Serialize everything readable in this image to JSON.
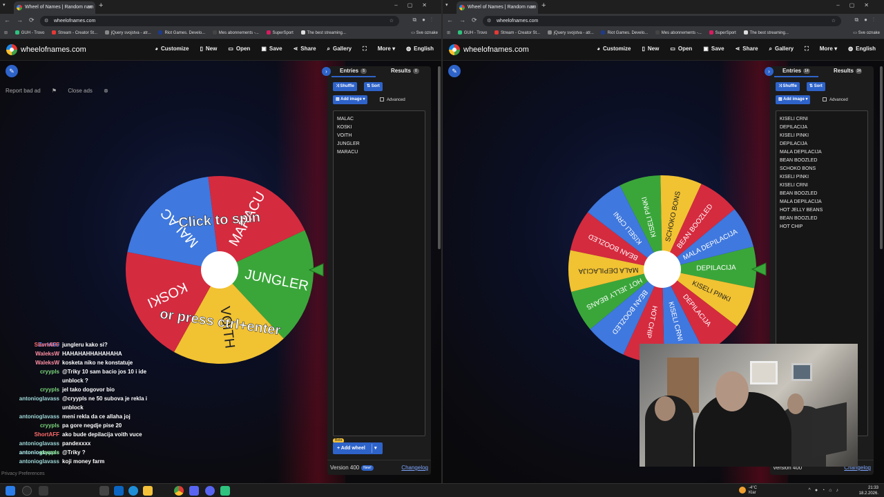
{
  "left": {
    "tab_title": "Wheel of Names | Random nam",
    "url": "wheelofnames.com",
    "bookmarks": [
      "GUH - Trovo",
      "Stream - Creator St...",
      "jQuery svojstva - atr...",
      "Riot Games. Develo...",
      "Mes abonnements -...",
      "SuperSport",
      "The best streaming..."
    ],
    "bookmarks_end": "Sve oznake",
    "site_name": "wheelofnames.com",
    "menu": [
      "Customize",
      "New",
      "Open",
      "Save",
      "Share",
      "Gallery",
      "More",
      "English"
    ],
    "report_bad_ad": "Report bad ad",
    "close_ads": "Close ads",
    "tabs": {
      "entries": "Entries",
      "entries_count": "5",
      "results": "Results",
      "results_count": "0"
    },
    "buttons": {
      "shuffle": "Shuffle",
      "sort": "Sort",
      "add_image": "Add image",
      "advanced": "Advanced",
      "add_wheel": "Add wheel",
      "beta": "Beta"
    },
    "entries": [
      "MALAC",
      "KOSKI",
      "VOITH",
      "JUNGLER",
      "MARACU"
    ],
    "wheel": {
      "slices": [
        {
          "label": "JUNGLER",
          "color": "#3aa63a"
        },
        {
          "label": "VOITH",
          "color": "#f1c232"
        },
        {
          "label": "KOSKI",
          "color": "#d52b3f"
        },
        {
          "label": "MALAC",
          "color": "#3f78de"
        },
        {
          "label": "MARACU",
          "color": "#d52b3f"
        }
      ],
      "overlay_top": "Click to spin",
      "overlay_bottom": "or press ctrl+enter"
    },
    "version": "Version 400",
    "new_badge": "New!",
    "changelog": "Changelog",
    "privacy": "Privacy Preferences"
  },
  "right": {
    "tab_title": "Wheel of Names | Random nam",
    "url": "wheelofnames.com",
    "bookmarks": [
      "GUH - Trovo",
      "Stream - Creator St...",
      "jQuery svojstva - atr...",
      "Riot Games. Develo...",
      "Mes abonnements -...",
      "SuperSport",
      "The best streaming..."
    ],
    "bookmarks_end": "Sve oznake",
    "site_name": "wheelofnames.com",
    "menu": [
      "Customize",
      "New",
      "Open",
      "Save",
      "Share",
      "Gallery",
      "More",
      "English"
    ],
    "tabs": {
      "entries": "Entries",
      "entries_count": "14",
      "results": "Results",
      "results_count": "34"
    },
    "buttons": {
      "shuffle": "Shuffle",
      "sort": "Sort",
      "add_image": "Add image",
      "advanced": "Advanced"
    },
    "entries": [
      "KISELI CRNI",
      "DEPILACIJA",
      "KISELI PINKI",
      "DEPILACIJA",
      "MALA DEPILACIJA",
      "BEAN BOOZLED",
      "SCHOKO BONS",
      "KISELI PINKI",
      "KISELI CRNI",
      "BEAN BOOZLED",
      "MALA DEPILACIJA",
      "HOT JELLY BEANS",
      "BEAN BOOZLED",
      "HOT CHIP"
    ],
    "wheel": {
      "slices": [
        {
          "label": "DEPILACIJA",
          "color": "#3aa63a"
        },
        {
          "label": "KISELI PINKI",
          "color": "#f1c232"
        },
        {
          "label": "DEPILACIJA",
          "color": "#d52b3f"
        },
        {
          "label": "KISELI CRNI",
          "color": "#3f78de"
        },
        {
          "label": "HOT CHIP",
          "color": "#d52b3f"
        },
        {
          "label": "BEAN BOOZLED",
          "color": "#3f78de"
        },
        {
          "label": "HOT JELLY BEANS",
          "color": "#3aa63a"
        },
        {
          "label": "MALA DEPILACIJA",
          "color": "#f1c232"
        },
        {
          "label": "BEAN BOOZLED",
          "color": "#d52b3f"
        },
        {
          "label": "KISELI CRNI",
          "color": "#3f78de"
        },
        {
          "label": "KISELI PINKI",
          "color": "#3aa63a"
        },
        {
          "label": "SCHOKO BONS",
          "color": "#f1c232"
        },
        {
          "label": "BEAN BOOZLED",
          "color": "#d52b3f"
        },
        {
          "label": "MALA DEPILACIJA",
          "color": "#3f78de"
        }
      ]
    },
    "version": "Version 400",
    "changelog": "Changelog"
  },
  "chat": [
    {
      "user": "Zvrk000",
      "color": "#5b8cff",
      "msg": ""
    },
    {
      "user": "ShortAFF",
      "color": "#ff6b6b",
      "msg": "jungleru kako si?"
    },
    {
      "user": "WaleksW",
      "color": "#ff8fa3",
      "msg": "HAHAHAHHAHAHAHA"
    },
    {
      "user": "WaleksW",
      "color": "#ff8fa3",
      "msg": "kosketa niko ne konstatuje"
    },
    {
      "user": "cryypls",
      "color": "#7dd87d",
      "msg": "@Triky 10 sam bacio jos 10 i ide unblock ?"
    },
    {
      "user": "cryypls",
      "color": "#7dd87d",
      "msg": "jel tako dogovor bio"
    },
    {
      "user": "antonioglavass",
      "color": "#9fd9d9",
      "msg": "@cryypls ne 50 subova je rekla i unblock"
    },
    {
      "user": "antonioglavass",
      "color": "#9fd9d9",
      "msg": "meni rekla da ce allaha joj"
    },
    {
      "user": "cryypls",
      "color": "#7dd87d",
      "msg": "pa gore negdje pise 20"
    },
    {
      "user": "ShortAFF",
      "color": "#ff6b6b",
      "msg": "ako bude depilacija voith vuce"
    },
    {
      "user": "antonioglavass",
      "color": "#9fd9d9",
      "msg": "pandexxxx"
    },
    {
      "user": "antonioglavass",
      "color": "#9fd9d9",
      "msg": ""
    },
    {
      "user": "antonioglavass",
      "color": "#9fd9d9",
      "msg": ""
    },
    {
      "user": "cryypls",
      "color": "#7dd87d",
      "msg": "@Triky ?"
    },
    {
      "user": "antonioglavass",
      "color": "#9fd9d9",
      "msg": "koji money farm"
    }
  ],
  "taskbar": {
    "weather_temp": "-4°C",
    "weather_desc": "Klar",
    "time": "21:33",
    "date": "18.2.2026."
  }
}
